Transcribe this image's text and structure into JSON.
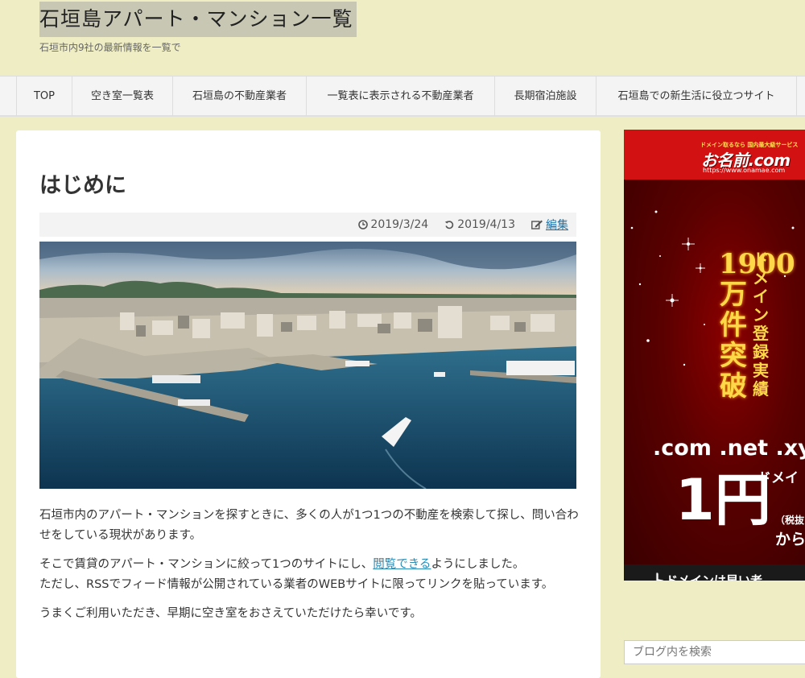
{
  "header": {
    "site_title": "石垣島アパート・マンション一覧",
    "tagline": "石垣市内9社の最新情報を一覧で"
  },
  "nav": {
    "items": [
      {
        "label": "TOP"
      },
      {
        "label": "空き室一覧表"
      },
      {
        "label": "石垣島の不動産業者"
      },
      {
        "label": "一覧表に表示される不動産業者"
      },
      {
        "label": "長期宿泊施設"
      },
      {
        "label": "石垣島での新生活に役立つサイト"
      }
    ]
  },
  "post": {
    "title": "はじめに",
    "published": "2019/3/24",
    "updated": "2019/4/13",
    "edit_label": "編集",
    "paragraphs": {
      "p1": "石垣市内のアパート・マンションを探すときに、多くの人が1つ1つの不動産を検索して探し、問い合わせをしている現状があります。",
      "p2_before": "そこで賃貸のアパート・マンションに絞って1つのサイトにし、",
      "p2_link": "閲覧できる",
      "p2_after": "ようにしました。",
      "p2_line2": "ただし、RSSでフィード情報が公開されている業者のWEBサイトに限ってリンクを貼っています。",
      "p3": "うまくご利用いただき、早期に空き室をおさえていただけたら幸いです。"
    }
  },
  "sidebar": {
    "ad": {
      "logo_tagline": "ドメイン取るなら 国内最大級サービス",
      "logo": "お名前.com",
      "logo_url": "https://www.onamae.com",
      "vertical_big": "1900万件突破",
      "vertical_small": "ドメイン登録実績",
      "tlds": ".com .net .xy",
      "domain_label": "ドメイ",
      "price": "1円",
      "price_note": "（税抜",
      "price_from": "から",
      "bottom_text": "ドメインは早い者"
    },
    "search_placeholder": "ブログ内を検索"
  },
  "colors": {
    "page_bg": "#eeedc4",
    "title_highlight": "#c7c7b4",
    "link": "#2a8bb5",
    "ad_red": "#c10f0f",
    "ad_gold": "#ffd84a"
  }
}
